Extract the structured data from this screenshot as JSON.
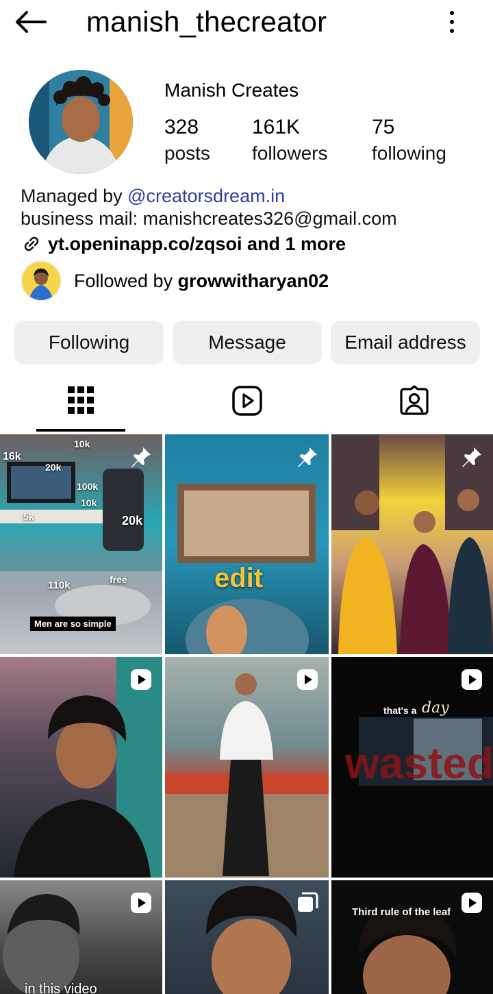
{
  "header": {
    "username": "manish_thecreator"
  },
  "profile": {
    "display_name": "Manish Creates",
    "stats": {
      "posts": {
        "count": "328",
        "label": "posts"
      },
      "followers": {
        "count": "161K",
        "label": "followers"
      },
      "following": {
        "count": "75",
        "label": "following"
      }
    },
    "bio": {
      "managed_prefix": "Managed by ",
      "managed_handle": "@creatorsdream.in",
      "business_mail": "business mail: manishcreates326@gmail.com",
      "link": "yt.openinapp.co/zqsoi and 1 more"
    },
    "followed_by": {
      "prefix": "Followed by ",
      "user": "growwitharyan02"
    }
  },
  "actions": {
    "following": "Following",
    "message": "Message",
    "email": "Email address"
  },
  "tabs": [
    {
      "name": "grid-icon"
    },
    {
      "name": "reels-icon"
    },
    {
      "name": "tagged-icon"
    }
  ],
  "grid": {
    "post1": {
      "labels": [
        "16k",
        "10k",
        "20k",
        "100k",
        "10k",
        "5k",
        "20k",
        "110k",
        "free"
      ],
      "caption": "Men are so simple"
    },
    "post2": {
      "caption": "edit"
    },
    "post6": {
      "caption_a": "that's a",
      "caption_b": "day",
      "caption_c": "wasted"
    },
    "post7": {
      "caption": "in this video"
    },
    "post9": {
      "caption": "Third rule of the leaf"
    }
  },
  "colors": {
    "mention": "#2e3ea0",
    "button_bg": "#efeff0"
  }
}
